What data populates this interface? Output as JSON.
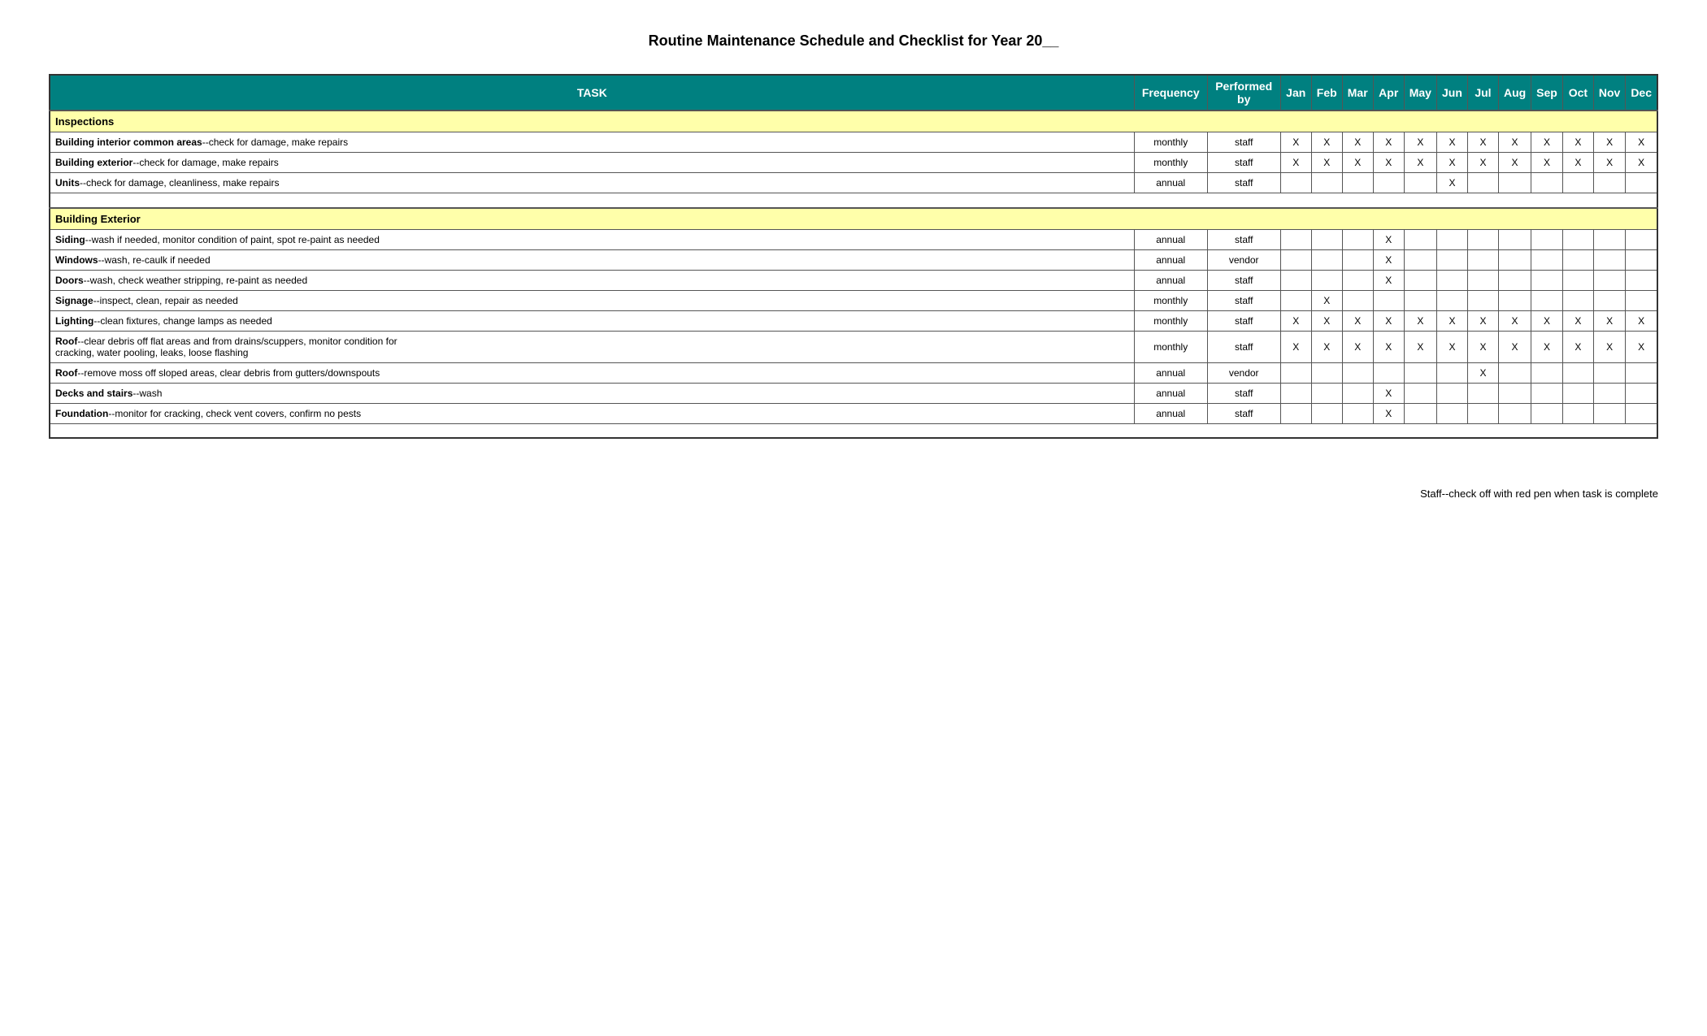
{
  "title": "Routine Maintenance Schedule and Checklist for Year 20__",
  "headers": {
    "task": "TASK",
    "frequency": "Frequency",
    "performed_by": "Performed by",
    "months": [
      "Jan",
      "Feb",
      "Mar",
      "Apr",
      "May",
      "Jun",
      "Jul",
      "Aug",
      "Sep",
      "Oct",
      "Nov",
      "Dec"
    ]
  },
  "sections": [
    {
      "id": "inspections",
      "label": "Inspections",
      "rows": [
        {
          "task_bold": "Building interior common areas",
          "task_detail": "--check for damage, make repairs",
          "frequency": "monthly",
          "performed_by": "staff",
          "marks": [
            1,
            1,
            1,
            1,
            1,
            1,
            1,
            1,
            1,
            1,
            1,
            1
          ]
        },
        {
          "task_bold": "Building exterior",
          "task_detail": "--check for damage, make repairs",
          "frequency": "monthly",
          "performed_by": "staff",
          "marks": [
            1,
            1,
            1,
            1,
            1,
            1,
            1,
            1,
            1,
            1,
            1,
            1
          ]
        },
        {
          "task_bold": "Units",
          "task_detail": "--check for damage, cleanliness, make repairs",
          "frequency": "annual",
          "performed_by": "staff",
          "marks": [
            0,
            0,
            0,
            0,
            0,
            1,
            0,
            0,
            0,
            0,
            0,
            0
          ]
        }
      ]
    },
    {
      "id": "building-exterior",
      "label": "Building Exterior",
      "rows": [
        {
          "task_bold": "Siding",
          "task_detail": "--wash if needed, monitor condition of paint, spot re-paint as needed",
          "frequency": "annual",
          "performed_by": "staff",
          "marks": [
            0,
            0,
            0,
            1,
            0,
            0,
            0,
            0,
            0,
            0,
            0,
            0
          ]
        },
        {
          "task_bold": "Windows",
          "task_detail": "--wash, re-caulk if needed",
          "frequency": "annual",
          "performed_by": "vendor",
          "marks": [
            0,
            0,
            0,
            1,
            0,
            0,
            0,
            0,
            0,
            0,
            0,
            0
          ]
        },
        {
          "task_bold": "Doors",
          "task_detail": "--wash, check weather stripping, re-paint as needed",
          "frequency": "annual",
          "performed_by": "staff",
          "marks": [
            0,
            0,
            0,
            1,
            0,
            0,
            0,
            0,
            0,
            0,
            0,
            0
          ]
        },
        {
          "task_bold": "Signage",
          "task_detail": "--inspect, clean, repair as needed",
          "frequency": "monthly",
          "performed_by": "staff",
          "marks": [
            0,
            1,
            0,
            0,
            0,
            0,
            0,
            0,
            0,
            0,
            0,
            0
          ]
        },
        {
          "task_bold": "Lighting",
          "task_detail": "--clean fixtures, change lamps as needed",
          "frequency": "monthly",
          "performed_by": "staff",
          "marks": [
            1,
            1,
            1,
            1,
            1,
            1,
            1,
            1,
            1,
            1,
            1,
            1
          ]
        },
        {
          "task_bold": "Roof",
          "task_detail": "--clear debris off flat areas and from drains/scuppers, monitor condition for cracking, water pooling, leaks, loose flashing",
          "frequency": "monthly",
          "performed_by": "staff",
          "marks": [
            1,
            1,
            1,
            1,
            1,
            1,
            1,
            1,
            1,
            1,
            1,
            1
          ],
          "multiline": true
        },
        {
          "task_bold": "Roof",
          "task_detail": "--remove moss off sloped areas, clear debris from gutters/downspouts",
          "frequency": "annual",
          "performed_by": "vendor",
          "marks": [
            0,
            0,
            0,
            0,
            0,
            0,
            1,
            0,
            0,
            0,
            0,
            0
          ]
        },
        {
          "task_bold": "Decks and stairs",
          "task_detail": "--wash",
          "frequency": "annual",
          "performed_by": "staff",
          "marks": [
            0,
            0,
            0,
            1,
            0,
            0,
            0,
            0,
            0,
            0,
            0,
            0
          ]
        },
        {
          "task_bold": "Foundation",
          "task_detail": "--monitor for cracking, check vent covers, confirm no pests",
          "frequency": "annual",
          "performed_by": "staff",
          "marks": [
            0,
            0,
            0,
            1,
            0,
            0,
            0,
            0,
            0,
            0,
            0,
            0
          ]
        }
      ]
    }
  ],
  "footer_note": "Staff--check off with red pen when task is complete"
}
